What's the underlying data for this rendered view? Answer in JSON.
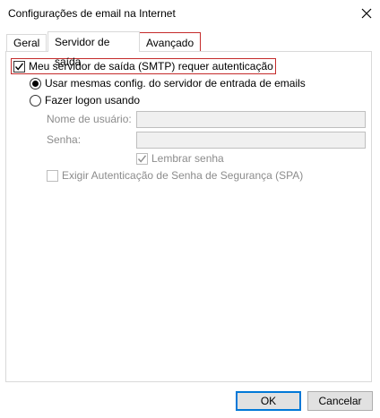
{
  "window": {
    "title": "Configurações de email na Internet",
    "close_icon": "close-icon"
  },
  "tabs": [
    {
      "label": "Geral"
    },
    {
      "label": "Servidor de saída"
    },
    {
      "label": "Avançado"
    }
  ],
  "outgoing": {
    "smtp_auth_label": "Meu servidor de saída (SMTP) requer autenticação",
    "smtp_auth_checked": true,
    "use_same_label": "Usar mesmas config. do servidor de entrada de emails",
    "logon_using_label": "Fazer logon usando",
    "username_label": "Nome de usuário:",
    "username_value": "",
    "password_label": "Senha:",
    "password_value": "",
    "remember_password_label": "Lembrar senha",
    "spa_label": "Exigir Autenticação de Senha de Segurança (SPA)"
  },
  "buttons": {
    "ok": "OK",
    "cancel": "Cancelar"
  },
  "colors": {
    "focus_outline": "#c42b2b",
    "default_button_border": "#0078d7",
    "disabled_text": "#8c8c8c"
  }
}
